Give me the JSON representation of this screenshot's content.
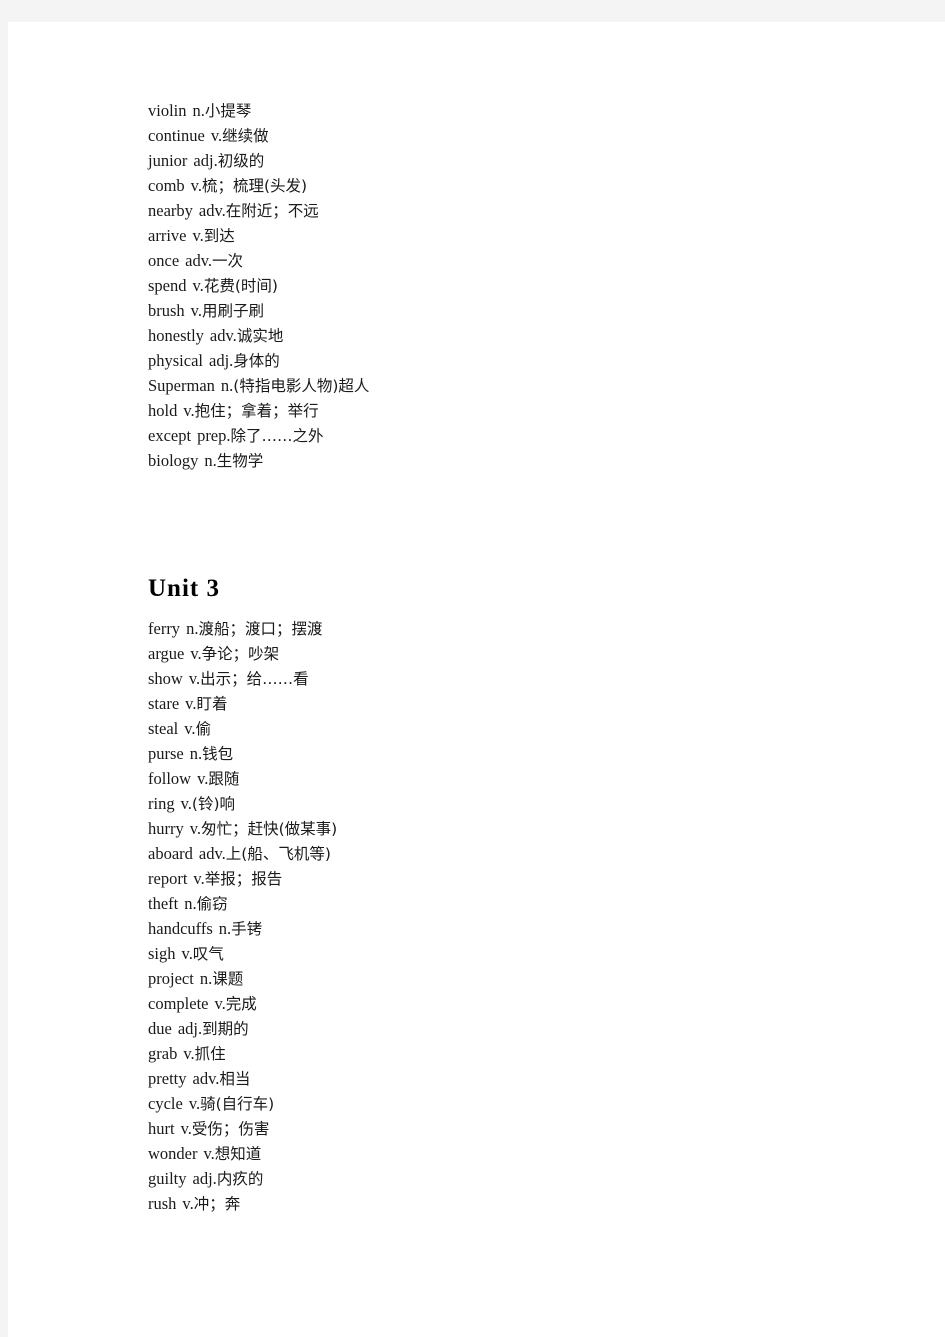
{
  "document": {
    "page_background": "#f4f4f4",
    "sheet_background": "#ffffff",
    "text_color": "#1a1a1a"
  },
  "sections": [
    {
      "heading": null,
      "entries": [
        {
          "word": "violin",
          "pos": "n.",
          "gloss": "小提琴"
        },
        {
          "word": "continue",
          "pos": "v.",
          "gloss": "继续做"
        },
        {
          "word": "junior",
          "pos": "adj.",
          "gloss": "初级的"
        },
        {
          "word": "comb",
          "pos": "v.",
          "gloss": "梳；梳理(头发)"
        },
        {
          "word": "nearby",
          "pos": "adv.",
          "gloss": "在附近；不远"
        },
        {
          "word": "arrive",
          "pos": "v.",
          "gloss": "到达"
        },
        {
          "word": "once",
          "pos": "adv.",
          "gloss": "一次"
        },
        {
          "word": "spend",
          "pos": "v.",
          "gloss": "花费(时间)"
        },
        {
          "word": "brush",
          "pos": "v.",
          "gloss": "用刷子刷"
        },
        {
          "word": "honestly",
          "pos": "adv.",
          "gloss": "诚实地"
        },
        {
          "word": "physical",
          "pos": "adj.",
          "gloss": "身体的"
        },
        {
          "word": "Superman",
          "pos": "n.",
          "gloss": "(特指电影人物)超人"
        },
        {
          "word": "hold",
          "pos": "v.",
          "gloss": "抱住；拿着；举行"
        },
        {
          "word": "except",
          "pos": "prep.",
          "gloss": "除了……之外"
        },
        {
          "word": "biology",
          "pos": "n.",
          "gloss": "生物学"
        }
      ]
    },
    {
      "heading": "Unit 3",
      "entries": [
        {
          "word": "ferry",
          "pos": "n.",
          "gloss": "渡船；渡口；摆渡"
        },
        {
          "word": "argue",
          "pos": "v.",
          "gloss": "争论；吵架"
        },
        {
          "word": "show",
          "pos": "v.",
          "gloss": "出示；给……看"
        },
        {
          "word": "stare",
          "pos": "v.",
          "gloss": "盯着"
        },
        {
          "word": "steal",
          "pos": "v.",
          "gloss": "偷"
        },
        {
          "word": "purse",
          "pos": "n.",
          "gloss": "钱包"
        },
        {
          "word": "follow",
          "pos": "v.",
          "gloss": "跟随"
        },
        {
          "word": "ring",
          "pos": "v.",
          "gloss": "(铃)响"
        },
        {
          "word": "hurry",
          "pos": "v.",
          "gloss": "匆忙；赶快(做某事)"
        },
        {
          "word": "aboard",
          "pos": "adv.",
          "gloss": "上(船、飞机等)"
        },
        {
          "word": "report",
          "pos": "v.",
          "gloss": "举报；报告"
        },
        {
          "word": "theft",
          "pos": "n.",
          "gloss": "偷窃"
        },
        {
          "word": "handcuffs",
          "pos": "n.",
          "gloss": "手铐"
        },
        {
          "word": "sigh",
          "pos": "v.",
          "gloss": "叹气"
        },
        {
          "word": "project",
          "pos": "n.",
          "gloss": "课题"
        },
        {
          "word": "complete",
          "pos": "v.",
          "gloss": "完成"
        },
        {
          "word": "due",
          "pos": "adj.",
          "gloss": "到期的"
        },
        {
          "word": "grab",
          "pos": "v.",
          "gloss": "抓住"
        },
        {
          "word": "pretty",
          "pos": "adv.",
          "gloss": "相当"
        },
        {
          "word": "cycle",
          "pos": "v.",
          "gloss": "骑(自行车)"
        },
        {
          "word": "hurt",
          "pos": "v.",
          "gloss": "受伤；伤害"
        },
        {
          "word": "wonder",
          "pos": "v.",
          "gloss": "想知道"
        },
        {
          "word": "guilty",
          "pos": "adj.",
          "gloss": "内疚的"
        },
        {
          "word": "rush",
          "pos": "v.",
          "gloss": "冲；奔"
        }
      ]
    }
  ]
}
